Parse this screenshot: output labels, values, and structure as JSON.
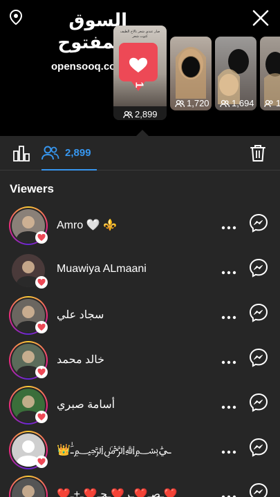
{
  "brand": {
    "arabic": "السوق المفتوح",
    "latin": "opensooq.com"
  },
  "stories": [
    {
      "count": "2,899",
      "active": true,
      "caption": "صار عندي شعر تالاخ الطيف كتوت شعر",
      "likes": "1"
    },
    {
      "count": "1,720"
    },
    {
      "count": "1,694"
    },
    {
      "count": "1,"
    }
  ],
  "toolbar": {
    "viewer_count": "2,899"
  },
  "section_title": "Viewers",
  "viewers": [
    {
      "name": "Amro 🤍 ⚜️",
      "story_ring": true,
      "avatar_color": "#8a8078"
    },
    {
      "name": "Muawiya ALmaani",
      "story_ring": false,
      "avatar_color": "#4a3a3a"
    },
    {
      "name": "سجاد علي",
      "story_ring": true,
      "avatar_color": "#6b6660"
    },
    {
      "name": "خالد محمد",
      "story_ring": true,
      "avatar_color": "#5b6b5a"
    },
    {
      "name": "أسامة صبري",
      "story_ring": true,
      "avatar_color": "#3a6e3a"
    },
    {
      "name": "👑ـيَٰ﷽ـَٰ",
      "story_ring": true,
      "avatar_color": "#cfcfcf"
    },
    {
      "name": "❤️ـصـ❤️ـر❤️ـحـ❤️ـ+ـ❤️",
      "story_ring": true,
      "avatar_color": "#555"
    }
  ],
  "colors": {
    "accent": "#3797f0",
    "like": "#ed4956",
    "background": "#262626"
  }
}
